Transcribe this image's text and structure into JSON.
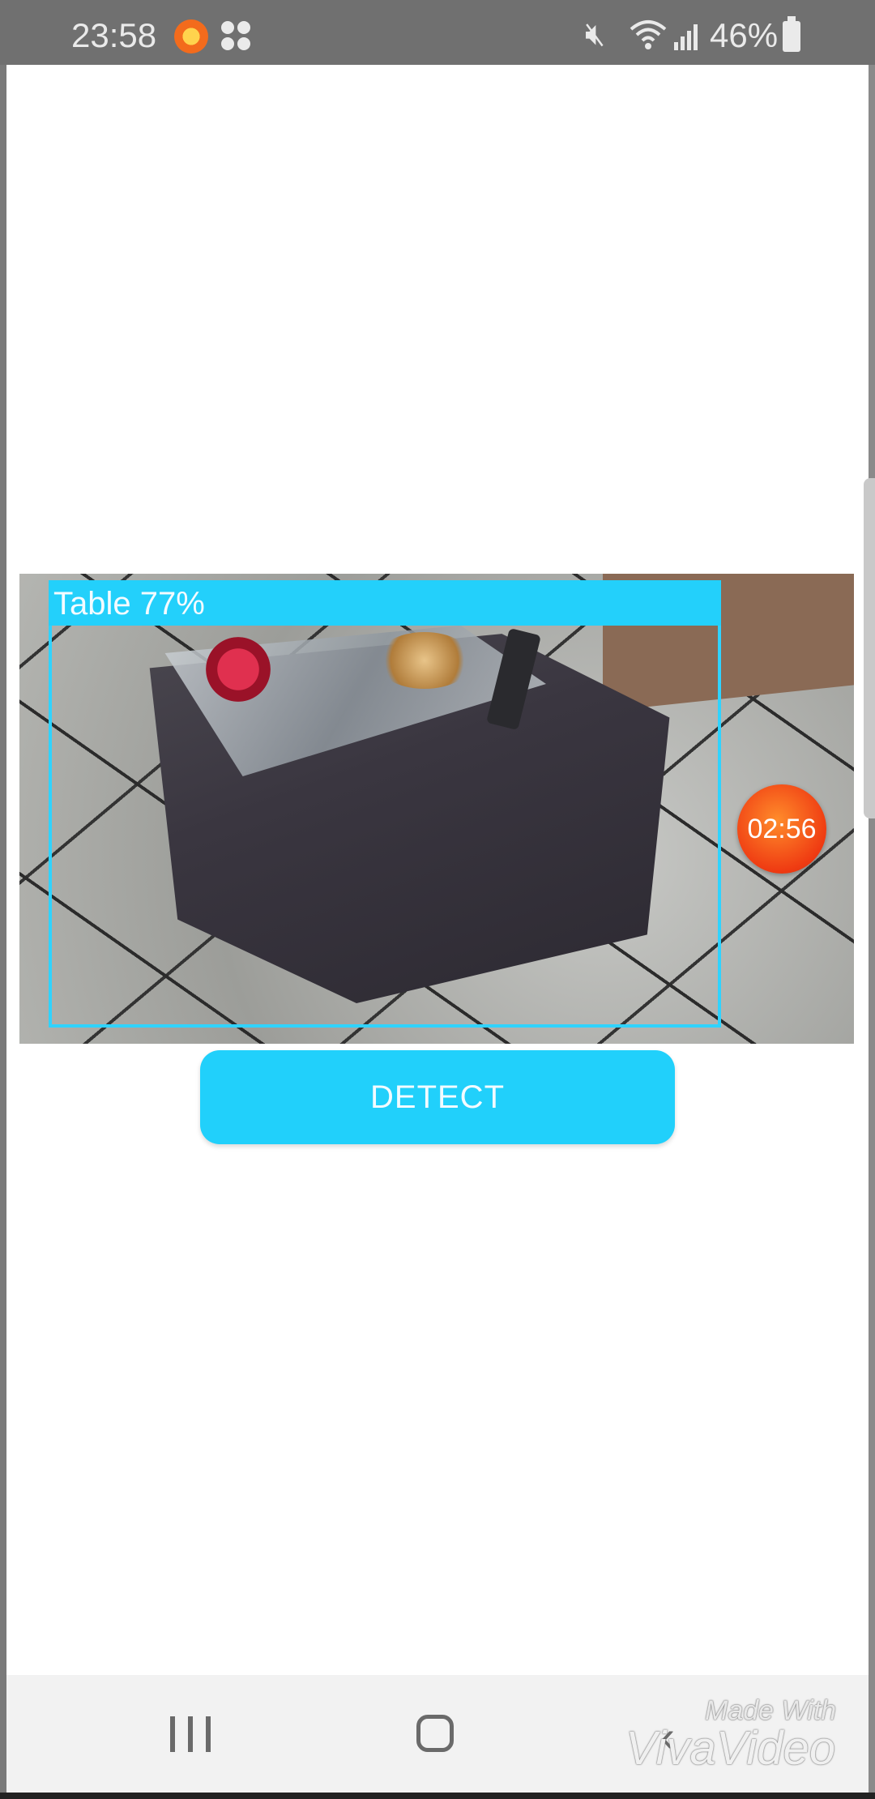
{
  "status_bar": {
    "time": "23:58",
    "battery_text": "46%",
    "icons": [
      "app-notification-icon",
      "apps-grid-icon",
      "mute-icon",
      "wifi-icon",
      "signal-icon",
      "battery-icon"
    ]
  },
  "camera_view": {
    "detection_label": "Table 77%",
    "box_color": "#2fd3ff"
  },
  "timer_badge": "02:56",
  "detect_button": "DETECT",
  "nav_bar": {
    "buttons": [
      "recent-apps",
      "home",
      "back"
    ]
  },
  "watermark": {
    "line1": "Made With",
    "line2": "VivaVideo"
  },
  "colors": {
    "accent": "#21d0fb",
    "status_bar": "#707070",
    "timer": "#ef3b12"
  }
}
